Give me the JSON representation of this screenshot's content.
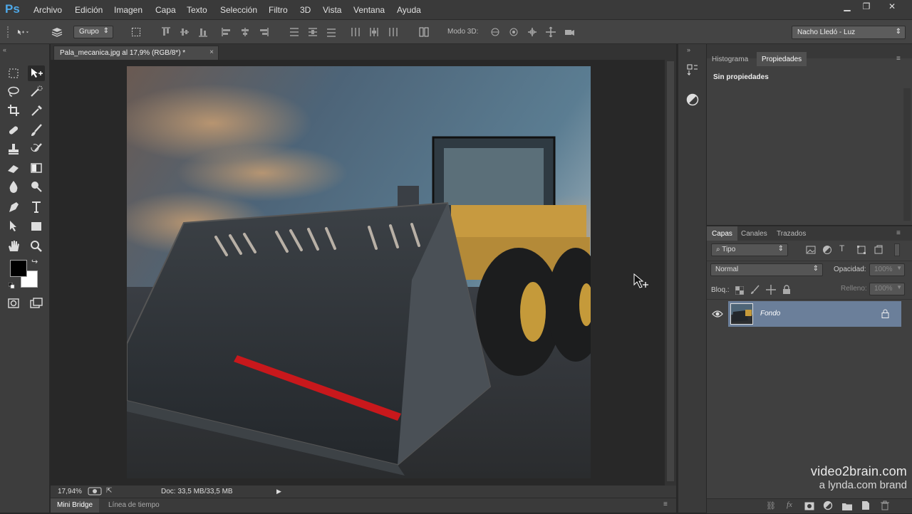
{
  "app": {
    "logo": "Ps"
  },
  "menu": [
    "Archivo",
    "Edición",
    "Imagen",
    "Capa",
    "Texto",
    "Selección",
    "Filtro",
    "3D",
    "Vista",
    "Ventana",
    "Ayuda"
  ],
  "window_controls": {
    "minimize": "▁",
    "restore": "❐",
    "close": "✕"
  },
  "options_bar": {
    "auto_select_target": "Grupo",
    "mode_3d_label": "Modo 3D:",
    "workspace": "Nacho Lledó - Luz"
  },
  "document": {
    "tab_title": "Pala_mecanica.jpg al 17,9% (RGB/8*) *",
    "close_glyph": "×",
    "zoom": "17,94%",
    "doc_size": "Doc: 33,5 MB/33,5 MB"
  },
  "bottom_tabs": [
    "Mini Bridge",
    "Línea de tiempo"
  ],
  "properties_panel": {
    "tabs": [
      "Histograma",
      "Propiedades"
    ],
    "active_tab": "Propiedades",
    "content": "Sin propiedades"
  },
  "layers_panel": {
    "tabs": [
      "Capas",
      "Canales",
      "Trazados"
    ],
    "active_tab": "Capas",
    "filter_kind": "Tipo",
    "blend_mode": "Normal",
    "opacity_label": "Opacidad:",
    "opacity_value": "100%",
    "lock_label": "Bloq.:",
    "fill_label": "Relleno:",
    "fill_value": "100%",
    "layers": [
      {
        "name": "Fondo",
        "visible": true,
        "locked": true
      }
    ]
  },
  "watermark": {
    "line1": "video2brain.com",
    "line2": "a lynda.com brand"
  },
  "colors": {
    "accent_logo": "#4ea8e8",
    "selected_layer": "#6b7f9a",
    "foreground": "#000000",
    "background": "#ffffff"
  }
}
